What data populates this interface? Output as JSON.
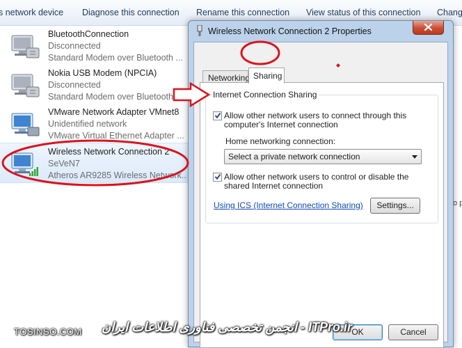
{
  "toolbar": {
    "items": [
      "s network device",
      "Diagnose this connection",
      "Rename this connection",
      "View status of this connection",
      "Chang"
    ]
  },
  "adapters": [
    {
      "name": "BluetoothConnection",
      "status": "Disconnected",
      "device": "Standard Modem over Bluetooth ..."
    },
    {
      "name": "Nokia USB Modem (NPCIA)",
      "status": "Disconnected",
      "device": "Standard Modem over Bluetooth ..."
    },
    {
      "name": "VMware Network Adapter VMnet8",
      "status": "Unidentified network",
      "device": "VMware Virtual Ethernet Adapter ..."
    },
    {
      "name": "Wireless Network Connection 2",
      "status": "SeVeN7",
      "device": "Atheros AR9285 Wireless Network..."
    }
  ],
  "side_note": "No p",
  "dialog": {
    "title": "Wireless Network Connection 2 Properties",
    "tabs": {
      "networking": "Networking",
      "sharing": "Sharing"
    },
    "group_title": "Internet Connection Sharing",
    "allow_connect": {
      "label_line1": "Allow other network users to connect through this",
      "label_line2": "computer's Internet connection",
      "checked": true
    },
    "home_label": "Home networking connection:",
    "home_select": "Select a private network connection",
    "allow_control": {
      "label_line1": "Allow other network users to control or disable the",
      "label_line2": "shared Internet connection",
      "checked": true
    },
    "ics_link": "Using ICS (Internet Connection Sharing)",
    "settings_label": "Settings...",
    "ok_label": "OK",
    "cancel_label": "Cancel"
  },
  "watermark": {
    "left": "TOSINSO.COM",
    "right": "ITPro.ir - انجمن تخصصی فناوری اطلاعات ایران"
  },
  "colors": {
    "annotation_red": "#d8141e",
    "link_blue": "#0f49b5",
    "title_blue": "#1e395b"
  }
}
